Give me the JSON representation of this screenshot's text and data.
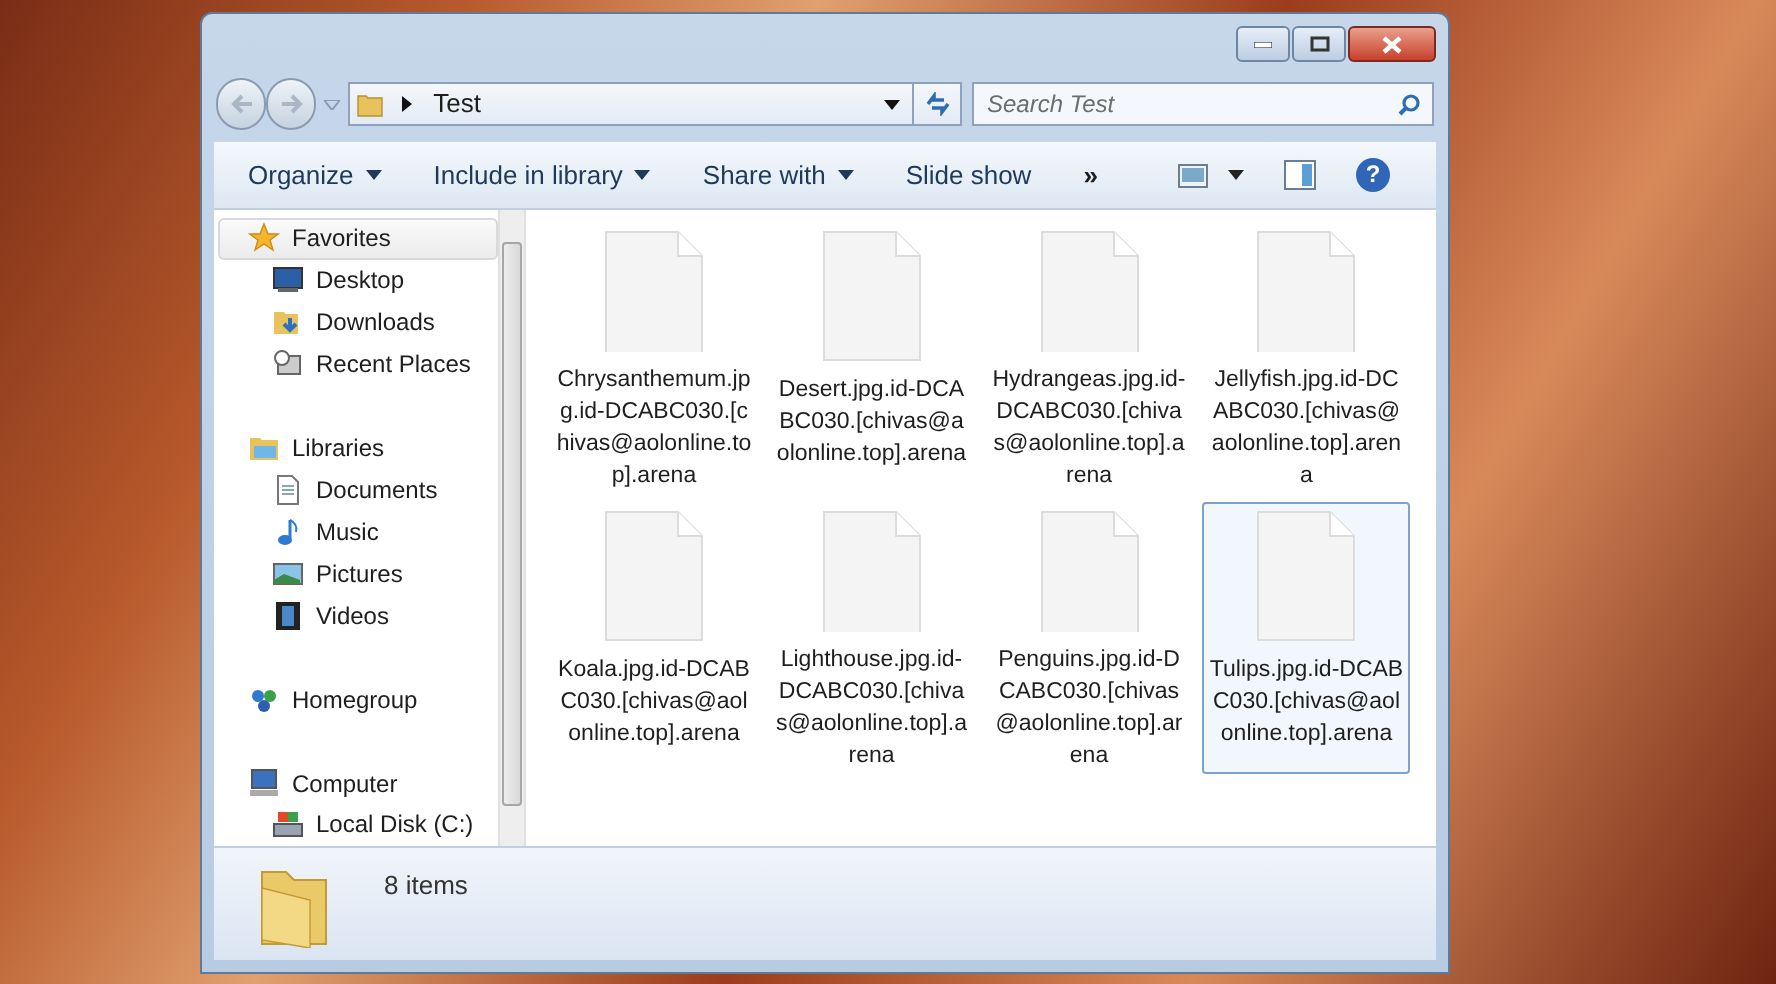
{
  "address_bar": {
    "path": "Test"
  },
  "search": {
    "placeholder": "Search Test"
  },
  "toolbar": {
    "items": [
      {
        "label": "Organize",
        "dropdown": true
      },
      {
        "label": "Include in library",
        "dropdown": true
      },
      {
        "label": "Share with",
        "dropdown": true
      },
      {
        "label": "Slide show",
        "dropdown": false
      }
    ],
    "overflow": "»",
    "help": "?"
  },
  "sidebar": {
    "groups": [
      {
        "label": "Favorites",
        "kind": "favorites",
        "selected": true,
        "children": [
          {
            "label": "Desktop",
            "kind": "desktop"
          },
          {
            "label": "Downloads",
            "kind": "downloads"
          },
          {
            "label": "Recent Places",
            "kind": "recent"
          }
        ]
      },
      {
        "label": "Libraries",
        "kind": "libraries",
        "selected": false,
        "children": [
          {
            "label": "Documents",
            "kind": "documents"
          },
          {
            "label": "Music",
            "kind": "music"
          },
          {
            "label": "Pictures",
            "kind": "pictures"
          },
          {
            "label": "Videos",
            "kind": "videos"
          }
        ]
      },
      {
        "label": "Homegroup",
        "kind": "homegroup",
        "selected": false
      },
      {
        "label": "Computer",
        "kind": "computer",
        "selected": false,
        "children": [
          {
            "label": "Local Disk (C:)",
            "kind": "disk"
          }
        ]
      }
    ]
  },
  "files": [
    {
      "name": "Chrysanthemum.jpg.id-DCABC030.[chivas@aolonline.top].arena",
      "selected": false
    },
    {
      "name": "Desert.jpg.id-DCABC030.[chivas@aolonline.top].arena",
      "selected": false
    },
    {
      "name": "Hydrangeas.jpg.id-DCABC030.[chivas@aolonline.top].arena",
      "selected": false
    },
    {
      "name": "Jellyfish.jpg.id-DCABC030.[chivas@aolonline.top].arena",
      "selected": false
    },
    {
      "name": "Koala.jpg.id-DCABC030.[chivas@aolonline.top].arena",
      "selected": false
    },
    {
      "name": "Lighthouse.jpg.id-DCABC030.[chivas@aolonline.top].arena",
      "selected": false
    },
    {
      "name": "Penguins.jpg.id-DCABC030.[chivas@aolonline.top].arena",
      "selected": false
    },
    {
      "name": "Tulips.jpg.id-DCABC030.[chivas@aolonline.top].arena",
      "selected": true
    }
  ],
  "details_pane": {
    "count": "8 items"
  }
}
